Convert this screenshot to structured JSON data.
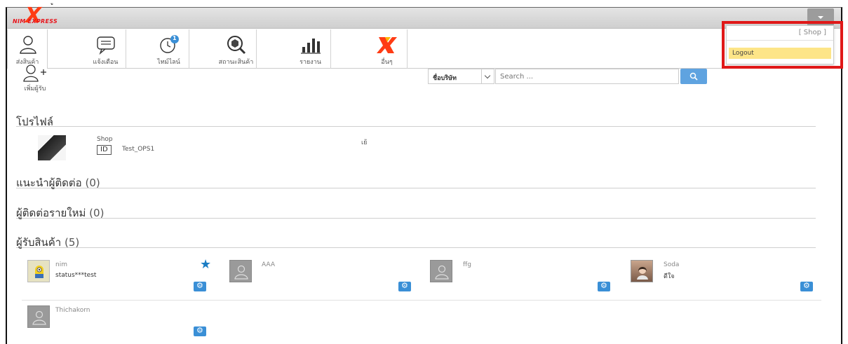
{
  "topstrip_glyph": "ู",
  "logo": {
    "mark": "X",
    "text": "NIM EXPRESS"
  },
  "toolbar": [
    {
      "name": "tool-send",
      "label": "ส่งสินค้า",
      "icon": "person-icon"
    },
    {
      "name": "tool-notify",
      "label": "แจ้งเตือน",
      "icon": "chat-icon"
    },
    {
      "name": "tool-timeline",
      "label": "ไทม์ไลน์",
      "icon": "clock-icon",
      "badge": "1"
    },
    {
      "name": "tool-status",
      "label": "สถานะสินค้า",
      "icon": "box-search-icon"
    },
    {
      "name": "tool-report",
      "label": "รายงาน",
      "icon": "bar-chart-icon"
    },
    {
      "name": "tool-other",
      "label": "อื่นๆ",
      "icon": "nim-logo-icon"
    }
  ],
  "add_receiver": {
    "label": "เพิ่มผู้รับ"
  },
  "search": {
    "filter_label": "ชื่อบริษัท",
    "placeholder": "Search ..."
  },
  "sections": {
    "profile": "โปรไฟล์",
    "suggested": {
      "label": "แนะนำผู้ติดต่อ",
      "count": "(0)"
    },
    "new_contacts": {
      "label": "ผู้ติดต่อรายใหม่",
      "count": "(0)"
    },
    "receivers": {
      "label": "ผู้รับสินค้า",
      "count": "(5)"
    }
  },
  "profile": {
    "name": "Shop",
    "id_badge": "ID",
    "id_value": "Test_OPS1",
    "extra": "เย้"
  },
  "receivers": [
    {
      "name": "nim",
      "status": "status***test",
      "starred": true
    },
    {
      "name": "AAA",
      "status": ""
    },
    {
      "name": "ffg",
      "status": ""
    },
    {
      "name": "Soda",
      "status": "ดีใจ"
    },
    {
      "name": "Thichakorn",
      "status": ""
    }
  ],
  "user_menu": {
    "shop": "[ Shop ]",
    "logout": "Logout"
  },
  "colors": {
    "accent": "#3a8fd6",
    "highlight": "#e01818",
    "logout_bg": "#fde588"
  }
}
